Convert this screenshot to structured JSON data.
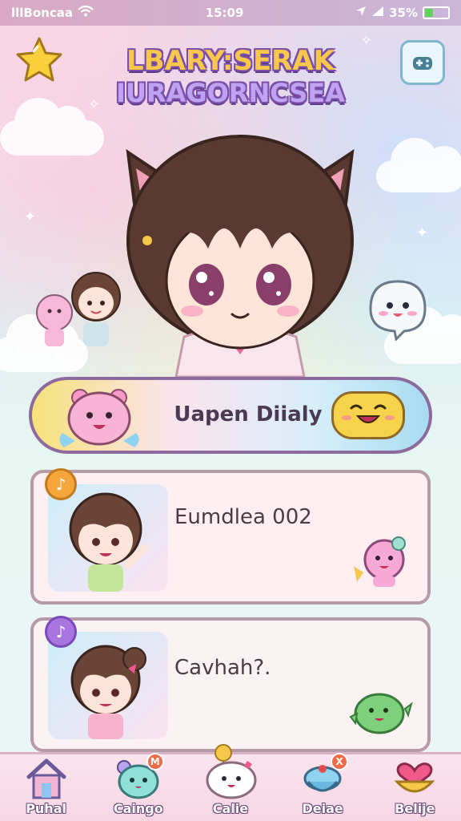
{
  "status_bar": {
    "carrier": "lllBoncaa",
    "time": "15:09",
    "battery": "35%",
    "battery_level": 0.35,
    "battery_color": "#5fd35a"
  },
  "header": {
    "title_line1": "LBARY:SERAK",
    "title_line2": "IURAGORNCSEA",
    "favorite_icon": "star-icon",
    "menu_icon": "controller-icon"
  },
  "daily_banner": {
    "label": "Uapen Diialy"
  },
  "cards": [
    {
      "label": "Eumdlea 002",
      "pin_icon": "music-note-icon",
      "pin_glyph": "♪"
    },
    {
      "label": "Cavhah?.",
      "pin_icon": "music-note-icon",
      "pin_glyph": "♪"
    }
  ],
  "nav": {
    "items": [
      {
        "label": "Puhal",
        "icon": "house-icon",
        "badge": ""
      },
      {
        "label": "Caingo",
        "icon": "pet-icon",
        "badge": "M"
      },
      {
        "label": "Calie",
        "icon": "mochi-icon",
        "badge": ""
      },
      {
        "label": "Deiae",
        "icon": "cake-icon",
        "badge": "X"
      },
      {
        "label": "Belije",
        "icon": "heart-bowl-icon",
        "badge": ""
      }
    ]
  },
  "colors": {
    "accent_purple": "#7b4fa8",
    "accent_pink": "#f7a8c4",
    "accent_yellow": "#f7c84a"
  }
}
